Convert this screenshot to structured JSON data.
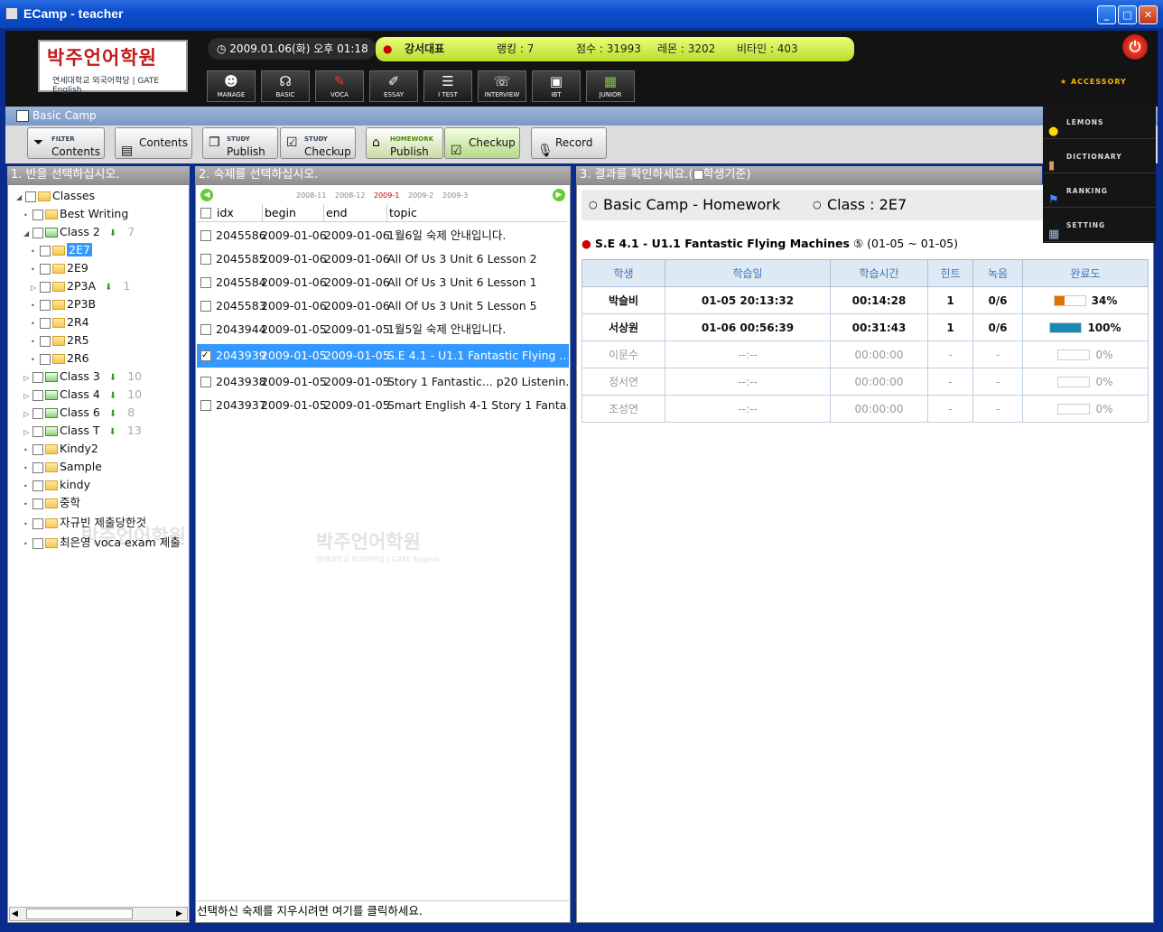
{
  "window": {
    "title": "ECamp - teacher",
    "min": "_",
    "max": "□",
    "close": "✕"
  },
  "header": {
    "logo_main": "박주언어학원",
    "logo_sub": "연세대학교 외국어학당 | GATE English",
    "datetime": "2009.01.06(화) 오후 01:18",
    "user": "강서대표",
    "rank": "랭킹 : 7",
    "score": "점수 : 31993",
    "lemon": "레몬 : 3202",
    "vitamin": "비타민 : 403",
    "nav": [
      {
        "label": "MANAGE",
        "icon": "manage-icon"
      },
      {
        "label": "BASIC",
        "icon": "headphones-icon"
      },
      {
        "label": "VOCA",
        "icon": "voca-icon"
      },
      {
        "label": "ESSAY",
        "icon": "pencil-icon"
      },
      {
        "label": "I TEST",
        "icon": "test-icon"
      },
      {
        "label": "INTERVIEW",
        "icon": "interview-icon"
      },
      {
        "label": "IBT",
        "icon": "computer-icon"
      },
      {
        "label": "JUNIOR",
        "icon": "junior-icon"
      }
    ],
    "accessory": "ACCESSORY"
  },
  "accessory_menu": [
    "LEMONS",
    "DICTIONARY",
    "RANKING",
    "SETTING"
  ],
  "subtitle": "Basic Camp",
  "toolbar": {
    "filter_small": "FILTER",
    "filter_big": "Contents",
    "contents": "Contents",
    "study_small": "STUDY",
    "publish": "Publish",
    "checkup": "Checkup",
    "homework_small": "HOMEWORK",
    "hw_publish": "Publish",
    "hw_checkup": "Checkup",
    "record": "Record"
  },
  "panel1": {
    "title": "1. 반을 선택하십시오.",
    "tree": [
      {
        "label": "Classes",
        "count": ""
      },
      {
        "label": "Best Writing",
        "count": ""
      },
      {
        "label": "Class 2",
        "count": "7"
      },
      {
        "label": "2E7",
        "count": ""
      },
      {
        "label": "2E9",
        "count": ""
      },
      {
        "label": "2P3A",
        "count": "1"
      },
      {
        "label": "2P3B",
        "count": ""
      },
      {
        "label": "2R4",
        "count": ""
      },
      {
        "label": "2R5",
        "count": ""
      },
      {
        "label": "2R6",
        "count": ""
      },
      {
        "label": "Class 3",
        "count": "10"
      },
      {
        "label": "Class 4",
        "count": "10"
      },
      {
        "label": "Class 6",
        "count": "8"
      },
      {
        "label": "Class T",
        "count": "13"
      },
      {
        "label": "Kindy2",
        "count": ""
      },
      {
        "label": "Sample",
        "count": ""
      },
      {
        "label": "kindy",
        "count": ""
      },
      {
        "label": "중학",
        "count": ""
      },
      {
        "label": "자규빈 제출당한것",
        "count": ""
      },
      {
        "label": "최은영 voca exam 제출",
        "count": ""
      }
    ]
  },
  "panel2": {
    "title": "2. 숙제를 선택하십시오.",
    "months": [
      "2008-11",
      "2008-12",
      "2009-1",
      "2009-2",
      "2009-3"
    ],
    "columns": [
      "idx",
      "begin",
      "end",
      "topic"
    ],
    "rows": [
      {
        "idx": "2045586",
        "begin": "2009-01-06",
        "end": "2009-01-06",
        "topic": "1월6일 숙제 안내입니다."
      },
      {
        "idx": "2045585",
        "begin": "2009-01-06",
        "end": "2009-01-06",
        "topic": "All Of Us 3 Unit 6 Lesson 2"
      },
      {
        "idx": "2045584",
        "begin": "2009-01-06",
        "end": "2009-01-06",
        "topic": "All Of Us 3 Unit 6 Lesson 1"
      },
      {
        "idx": "2045583",
        "begin": "2009-01-06",
        "end": "2009-01-06",
        "topic": "All Of Us 3 Unit 5 Lesson 5"
      },
      {
        "idx": "2043944",
        "begin": "2009-01-05",
        "end": "2009-01-05",
        "topic": "1월5일 숙제 안내입니다."
      },
      {
        "idx": "2043939",
        "begin": "2009-01-05",
        "end": "2009-01-05",
        "topic": "S.E 4.1 - U1.1 Fantastic Flying ..."
      },
      {
        "idx": "2043938",
        "begin": "2009-01-05",
        "end": "2009-01-05",
        "topic": "Story 1 Fantastic... p20 Listenin..."
      },
      {
        "idx": "2043937",
        "begin": "2009-01-05",
        "end": "2009-01-05",
        "topic": "Smart English 4-1 Story 1 Fanta..."
      }
    ],
    "footer": "선택하신 숙제를 지우시려면 여기를 클릭하세요."
  },
  "panel3": {
    "title": "3. 결과를 확인하세요.(",
    "title_check": "학생기준)",
    "camp": "Basic Camp - Homework",
    "class": "Class : 2E7",
    "hw": "S.E 4.1 - U1.1 Fantastic Flying Machines",
    "hw_num": "⑤",
    "hw_dates": "(01-05 ~ 01-05)",
    "columns": [
      "학생",
      "학습일",
      "학습시간",
      "힌트",
      "녹음",
      "완료도"
    ],
    "rows": [
      {
        "name": "박슬비",
        "date": "01-05 20:13:32",
        "time": "00:14:28",
        "hint": "1",
        "rec": "0/6",
        "pct": "34%",
        "fill": 0.34,
        "color": "#e07000"
      },
      {
        "name": "서상원",
        "date": "01-06 00:56:39",
        "time": "00:31:43",
        "hint": "1",
        "rec": "0/6",
        "pct": "100%",
        "fill": 1.0,
        "color": "#1a8ab5"
      },
      {
        "name": "이문수",
        "date": "--:--",
        "time": "00:00:00",
        "hint": "-",
        "rec": "-",
        "pct": "0%",
        "fill": 0,
        "color": "#1a8ab5"
      },
      {
        "name": "정서연",
        "date": "--:--",
        "time": "00:00:00",
        "hint": "-",
        "rec": "-",
        "pct": "0%",
        "fill": 0,
        "color": "#1a8ab5"
      },
      {
        "name": "조성연",
        "date": "--:--",
        "time": "00:00:00",
        "hint": "-",
        "rec": "-",
        "pct": "0%",
        "fill": 0,
        "color": "#1a8ab5"
      }
    ]
  }
}
